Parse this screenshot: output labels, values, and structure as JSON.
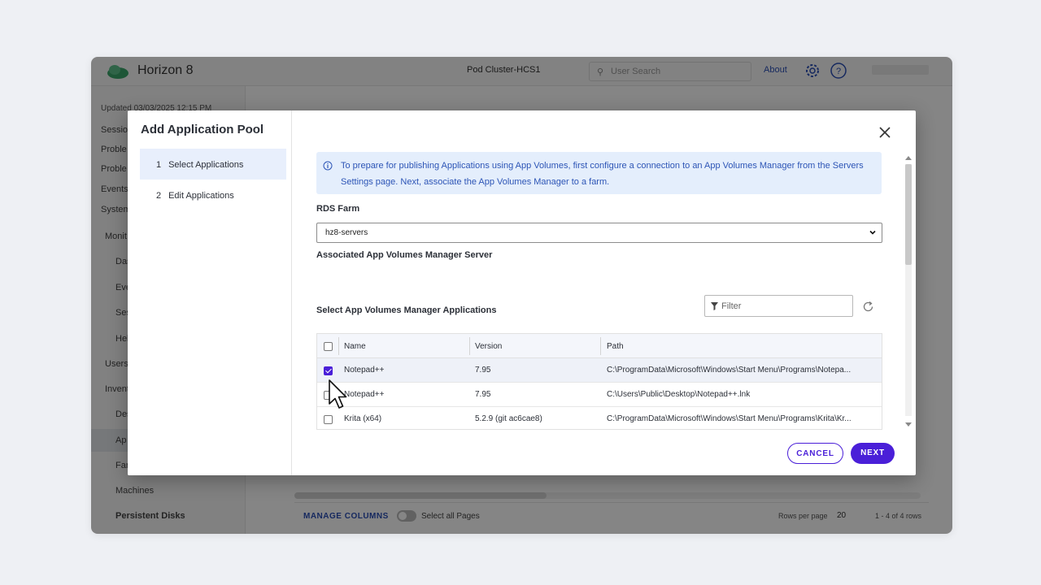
{
  "app": {
    "title": "Horizon 8",
    "pod": "Pod Cluster-HCS1",
    "search_placeholder": "User Search",
    "about": "About",
    "sidebar": {
      "updated": "Updated 03/03/2025 12:15 PM",
      "items": [
        "Session",
        "Proble",
        "Proble",
        "Events",
        "System",
        "Monit",
        "Das",
        "Eve",
        "Ses",
        "Hel",
        "Users",
        "Invent",
        "Des",
        "Ap",
        "Far",
        "Machines",
        "Persistent Disks"
      ]
    },
    "footer": {
      "manage_columns": "MANAGE COLUMNS",
      "select_all": "Select all Pages",
      "rows_per_page": "Rows per page",
      "rows_count": "20",
      "range": "1 - 4 of 4 rows"
    }
  },
  "modal": {
    "title": "Add Application Pool",
    "steps": [
      {
        "num": "1",
        "label": "Select Applications"
      },
      {
        "num": "2",
        "label": "Edit Applications"
      }
    ],
    "info": "To prepare for publishing Applications using App Volumes, first configure a connection to an App Volumes Manager from the Servers Settings page. Next, associate the App Volumes Manager to a farm.",
    "rds_farm_label": "RDS Farm",
    "rds_farm_value": "hz8-servers",
    "av_server_label": "Associated App Volumes Manager Server",
    "select_apps_label": "Select App Volumes Manager Applications",
    "filter_placeholder": "Filter",
    "table": {
      "columns": [
        "Name",
        "Version",
        "Path"
      ],
      "rows": [
        {
          "name": "Notepad++",
          "version": "7.95",
          "path": "C:\\ProgramData\\Microsoft\\Windows\\Start Menu\\Programs\\Notepa...",
          "checked": true
        },
        {
          "name": "Notepad++",
          "version": "7.95",
          "path": "C:\\Users\\Public\\Desktop\\Notepad++.lnk",
          "checked": false
        },
        {
          "name": "Krita (x64)",
          "version": "5.2.9 (git ac6cae8)",
          "path": "C:\\ProgramData\\Microsoft\\Windows\\Start Menu\\Programs\\Krita\\Kr...",
          "checked": false
        }
      ]
    },
    "cancel_label": "CANCEL",
    "next_label": "NEXT"
  },
  "colors": {
    "accent": "#4a1fd8",
    "info_bg": "#e4eefc",
    "info_text": "#2d55b6"
  }
}
